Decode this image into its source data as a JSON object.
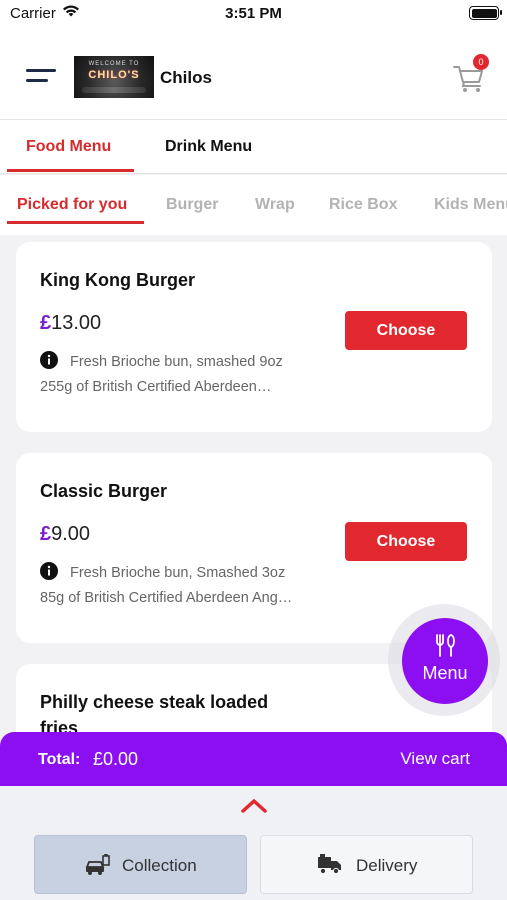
{
  "status_bar": {
    "carrier": "Carrier",
    "time": "3:51 PM"
  },
  "header": {
    "brand_name": "Chilos",
    "logo_line1": "WELCOME TO",
    "logo_line2": "CHILO'S",
    "cart_count": "0"
  },
  "menu_tabs": [
    {
      "label": "Food Menu",
      "active": true
    },
    {
      "label": "Drink Menu",
      "active": false
    }
  ],
  "categories": [
    {
      "label": "Picked for you",
      "active": true
    },
    {
      "label": "Burger"
    },
    {
      "label": "Wrap"
    },
    {
      "label": "Rice Box"
    },
    {
      "label": "Kids Menu"
    }
  ],
  "items": [
    {
      "name": "King Kong Burger",
      "currency": "£",
      "price": "13.00",
      "button": "Choose",
      "desc_line1": "Fresh Brioche bun, smashed 9oz",
      "desc_line2": "255g of British Certified Aberdeen…"
    },
    {
      "name": "Classic Burger",
      "currency": "£",
      "price": "9.00",
      "button": "Choose",
      "desc_line1": "Fresh Brioche bun, Smashed 3oz",
      "desc_line2": "85g of British Certified Aberdeen Ang…"
    },
    {
      "name": "Philly cheese steak loaded fries"
    }
  ],
  "fab": {
    "label": "Menu"
  },
  "total_bar": {
    "label": "Total:",
    "value": "£0.00",
    "view_cart": "View cart"
  },
  "order_type": {
    "collection": "Collection",
    "delivery": "Delivery",
    "selected": "Collection"
  },
  "colors": {
    "accent_red": "#e0282e",
    "accent_purple": "#8b0ff0",
    "tab_red": "#d42c2f"
  }
}
